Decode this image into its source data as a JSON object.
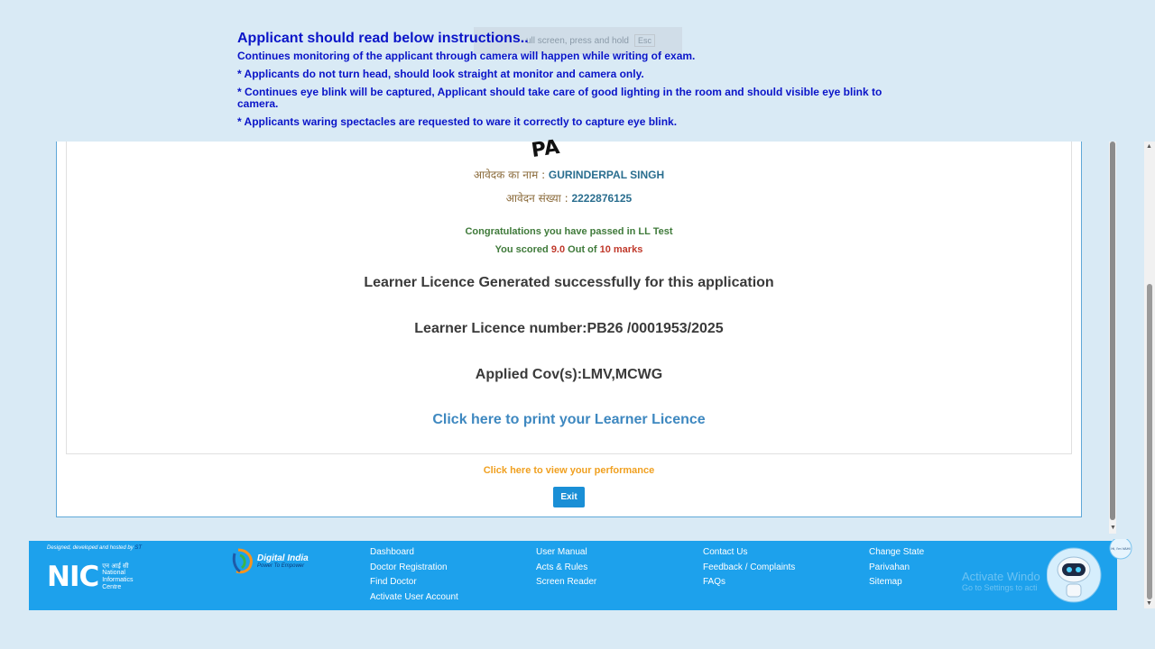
{
  "fullscreen_notice": {
    "text": "ull screen, press and hold",
    "key": "Esc"
  },
  "instructions": {
    "title": "Applicant should read below instructions..",
    "items": [
      "Continues monitoring of the applicant through camera will happen while writing of exam.",
      "* Applicants do not turn head, should look straight at monitor and camera only.",
      "* Continues eye blink will be captured, Applicant should take care of good lighting in the room and should visible eye blink to camera.",
      "* Applicants waring spectacles are requested to ware it correctly to capture eye blink."
    ]
  },
  "result": {
    "photo_fragment": "PA",
    "name_label": "आवेदक का नाम : ",
    "name_value": "GURINDERPAL SINGH",
    "appno_label": "आवेदन संख्या : ",
    "appno_value": "2222876125",
    "congrats": "Congratulations you have passed in LL Test",
    "score_prefix": "You scored ",
    "score_value": "9.0",
    "score_mid": " Out of ",
    "score_total": "10 marks",
    "generated": "Learner Licence Generated successfully for this application",
    "ll_number": "Learner Licence number:PB26 /0001953/2025",
    "cov": "Applied Cov(s):LMV,MCWG",
    "print_link": "Click here to print your Learner Licence",
    "performance_link": "Click here to view your performance",
    "exit_label": "Exit"
  },
  "footer": {
    "credit_prefix": "Designed, developed and hosted by ",
    "credit_highlight": "ST",
    "nic_letters": "NIC",
    "nic_hindi": "एन आई सी",
    "nic_lines": [
      "National",
      "Informatics",
      "Centre"
    ],
    "digital_india": "Digital India",
    "digital_india_tagline": "Power To Empower",
    "col1": [
      "Dashboard",
      "Doctor Registration",
      "Find Doctor",
      "Activate User Account"
    ],
    "col2": [
      "User Manual",
      "Acts & Rules",
      "Screen Reader"
    ],
    "col3": [
      "Contact Us",
      "Feedback / Complaints",
      "FAQs"
    ],
    "col4": [
      "Change State",
      "Parivahan",
      "Sitemap"
    ],
    "activate_title": "Activate Windo",
    "activate_sub": "Go to Settings to acti",
    "bot_text": "Hi, I'm VAHI"
  },
  "colors": {
    "page_bg": "#d9eaf5",
    "instruction_text": "#0a14c8",
    "footer_bg": "#1da1ec",
    "print_link": "#3e88c0",
    "performance_link": "#f0a020",
    "exit_button": "#1a8fd6",
    "pass_green": "#3f7a3a",
    "score_red": "#c0392b"
  }
}
